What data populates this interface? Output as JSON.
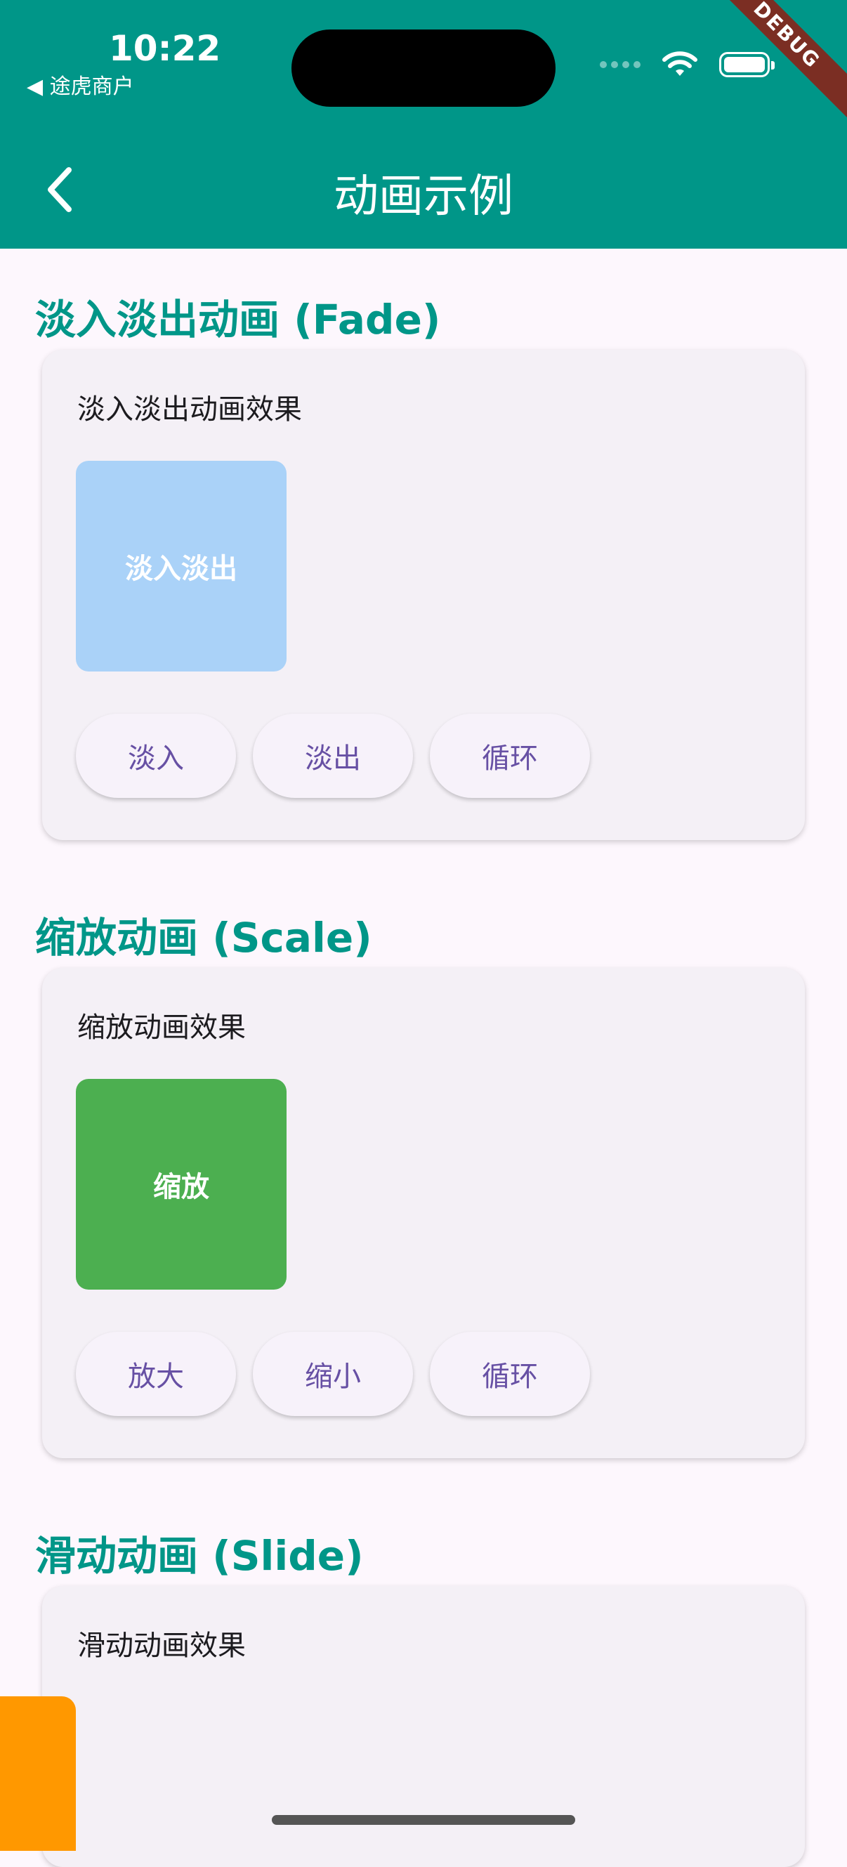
{
  "status_bar": {
    "time": "10:22",
    "back_app": "◀ 途虎商户"
  },
  "debug_banner": "DEBUG",
  "app_bar": {
    "title": "动画示例",
    "background": "#009688"
  },
  "sections": [
    {
      "title": "淡入淡出动画 (Fade)",
      "card_title": "淡入淡出动画效果",
      "box_label": "淡入淡出",
      "box_color": "#aad2f8",
      "buttons": [
        "淡入",
        "淡出",
        "循环"
      ]
    },
    {
      "title": "缩放动画 (Scale)",
      "card_title": "缩放动画效果",
      "box_label": "缩放",
      "box_color": "#4caf50",
      "buttons": [
        "放大",
        "缩小",
        "循环"
      ]
    },
    {
      "title": "滑动动画 (Slide)",
      "card_title": "滑动动画效果",
      "box_color": "#ff9800"
    }
  ],
  "colors": {
    "accent": "#009688",
    "button_text": "#6750a4",
    "card_bg": "#f4f0f6",
    "page_bg": "#fdf7fd"
  },
  "icons": {
    "back": "chevron-left-icon",
    "wifi": "wifi-icon",
    "battery": "battery-icon"
  }
}
